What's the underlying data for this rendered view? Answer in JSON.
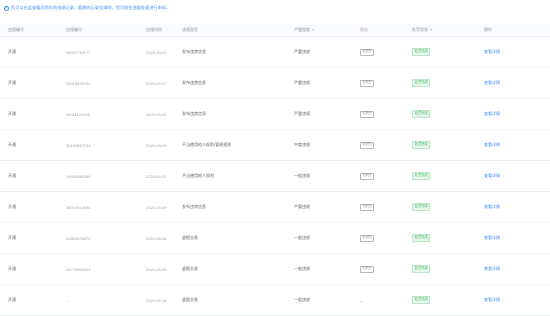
{
  "notice": {
    "icon": "info-icon",
    "text": "您可以在此查看近两年的违规记录，超期的记录会清除，您可前往违规处理进行申诉。"
  },
  "table": {
    "headers": [
      "违规编号",
      "违规编号",
      "违规时间",
      "违规类型",
      "严重程度",
      "积分",
      "处罚状态",
      "操作"
    ],
    "rows": [
      [
        "开通",
        "35447715177",
        "2023-10-01",
        "发布违禁信息",
        "严重违规",
        "无积分",
        "处罚完成",
        "查看详情"
      ],
      [
        "开通",
        "35415630191",
        "2023-09-27",
        "发布违禁信息",
        "严重违规",
        "无积分",
        "处罚完成",
        "查看详情"
      ],
      [
        "开通",
        "35311125445",
        "2023-09-20",
        "发布违禁信息",
        "严重违规",
        "无积分",
        "处罚完成",
        "查看详情"
      ],
      [
        "开通",
        "35193812703",
        "2023-09-09",
        "不当使用他人权利/管理规则",
        "中度违规",
        "无积分",
        "处罚完成",
        "查看详情"
      ],
      [
        "开通",
        "34890980350",
        "2023-09-01",
        "不当使用他人权利",
        "一般违规",
        "无积分",
        "处罚完成",
        "查看详情"
      ],
      [
        "开通",
        "35047614500",
        "2023-09-09",
        "发布违禁信息",
        "严重违规",
        "无积分",
        "处罚完成",
        "查看详情"
      ],
      [
        "开通",
        "34854533872",
        "2023-08-16",
        "虚假交易",
        "一般违规",
        "无积分",
        "处罚完成",
        "查看详情"
      ],
      [
        "开通",
        "34776594023",
        "2023-08-09",
        "虚假交易",
        "一般违规",
        "无积分",
        "处罚完成",
        "查看详情"
      ],
      [
        "开通",
        "--",
        "2023-06-16",
        "虚假交易",
        "一般违规",
        "--",
        "处罚完成",
        "查看详情"
      ]
    ]
  },
  "colors": {
    "accent": "#3e8ef7",
    "success": "#3fb760",
    "border": "#ebeef5"
  }
}
